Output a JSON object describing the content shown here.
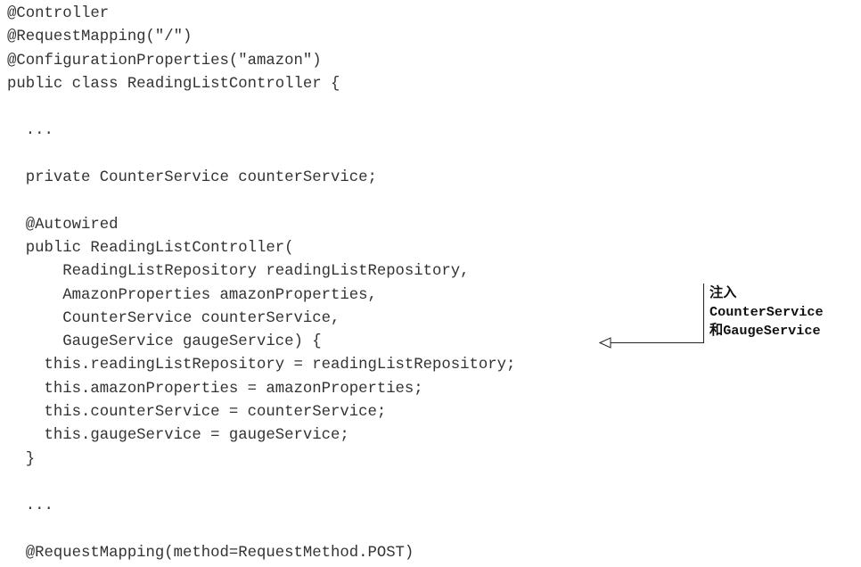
{
  "code": {
    "lines": [
      "@Controller",
      "@RequestMapping(\"/\")",
      "@ConfigurationProperties(\"amazon\")",
      "public class ReadingListController {",
      "",
      "  ...",
      "",
      "  private CounterService counterService;",
      "",
      "  @Autowired",
      "  public ReadingListController(",
      "      ReadingListRepository readingListRepository,",
      "      AmazonProperties amazonProperties,",
      "      CounterService counterService,",
      "      GaugeService gaugeService) {",
      "    this.readingListRepository = readingListRepository;",
      "    this.amazonProperties = amazonProperties;",
      "    this.counterService = counterService;",
      "    this.gaugeService = gaugeService;",
      "  }",
      "",
      "  ...",
      "",
      "  @RequestMapping(method=RequestMethod.POST)"
    ]
  },
  "annotation": {
    "line1": "注入",
    "line2": "CounterService",
    "line3": "和GaugeService",
    "arrow_icon": "hollow-triangle-arrow-left"
  }
}
